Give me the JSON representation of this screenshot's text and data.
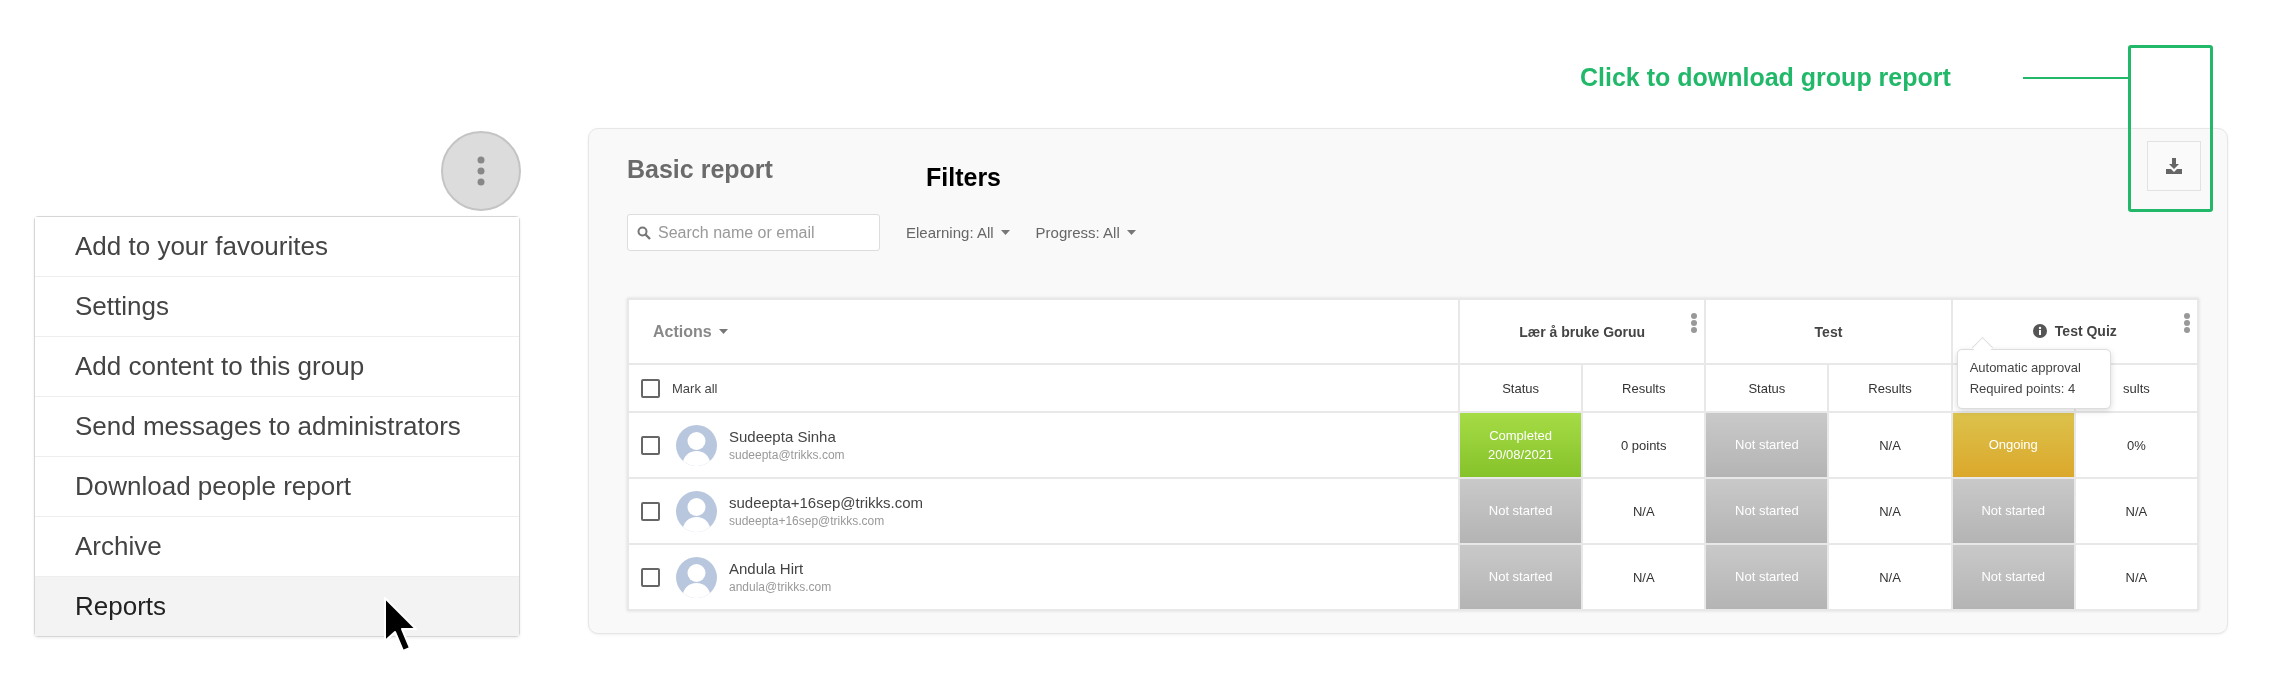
{
  "menu": {
    "items": [
      {
        "label": "Add to your favourites",
        "selected": false
      },
      {
        "label": "Settings",
        "selected": false
      },
      {
        "label": "Add content to this group",
        "selected": false
      },
      {
        "label": "Send messages to administrators",
        "selected": false
      },
      {
        "label": "Download people report",
        "selected": false
      },
      {
        "label": "Archive",
        "selected": false
      },
      {
        "label": "Reports",
        "selected": true
      }
    ]
  },
  "annotations": {
    "download": "Click to download group report",
    "filters": "Filters"
  },
  "report": {
    "title": "Basic report",
    "search": {
      "placeholder": "Search name or email"
    },
    "filters": [
      "Elearning: All",
      "Progress: All"
    ],
    "table": {
      "actions": "Actions",
      "mark_all": {
        "label": "Mark all",
        "checked": false
      },
      "groups": [
        {
          "title": "Lær å bruke Goruu",
          "info": false,
          "has_menu": true,
          "columns": [
            {
              "label": "Status"
            },
            {
              "label": "Results"
            }
          ]
        },
        {
          "title": "Test",
          "info": false,
          "has_menu": false,
          "columns": [
            {
              "label": "Status"
            },
            {
              "label": "Results"
            }
          ]
        },
        {
          "title": "Test Quiz",
          "info": true,
          "has_menu": true,
          "columns": [
            {},
            {
              "label": "sults"
            }
          ],
          "tooltip": [
            "Automatic approval",
            "Required points: 4"
          ]
        }
      ],
      "rows": [
        {
          "name": "Sudeepta Sinha",
          "email": "sudeepta@trikks.com",
          "checked": false,
          "cells": [
            {
              "kind": "completed",
              "lines": [
                "Completed",
                "20/08/2021"
              ],
              "result": "0 points"
            },
            {
              "kind": "not_started",
              "lines": [
                "Not started"
              ],
              "result": "N/A"
            },
            {
              "kind": "ongoing",
              "lines": [
                "Ongoing"
              ],
              "result": "0%"
            }
          ]
        },
        {
          "name": "sudeepta+16sep@trikks.com",
          "email": "sudeepta+16sep@trikks.com",
          "checked": false,
          "cells": [
            {
              "kind": "not_started",
              "lines": [
                "Not started"
              ],
              "result": "N/A"
            },
            {
              "kind": "not_started",
              "lines": [
                "Not started"
              ],
              "result": "N/A"
            },
            {
              "kind": "not_started",
              "lines": [
                "Not started"
              ],
              "result": "N/A"
            }
          ]
        },
        {
          "name": "Andula Hirt",
          "email": "andula@trikks.com",
          "checked": false,
          "cells": [
            {
              "kind": "not_started",
              "lines": [
                "Not started"
              ],
              "result": "N/A"
            },
            {
              "kind": "not_started",
              "lines": [
                "Not started"
              ],
              "result": "N/A"
            },
            {
              "kind": "not_started",
              "lines": [
                "Not started"
              ],
              "result": "N/A"
            }
          ]
        }
      ]
    }
  }
}
